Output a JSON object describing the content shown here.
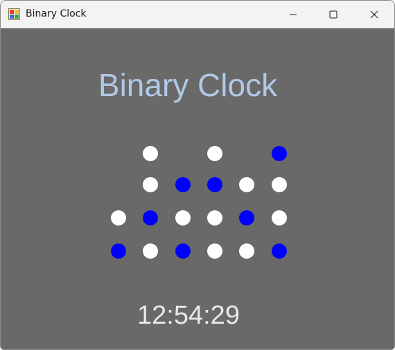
{
  "window": {
    "title": "Binary Clock",
    "controls": [
      "minimize",
      "maximize",
      "close"
    ]
  },
  "app": {
    "heading": "Binary Clock",
    "time": "12:54:29",
    "dot_colors": {
      "on": "#0000ff",
      "off": "#ffffff"
    },
    "columns": [
      {
        "digit": 1,
        "bits": [
          null,
          null,
          0,
          1
        ]
      },
      {
        "digit": 2,
        "bits": [
          0,
          0,
          1,
          0
        ]
      },
      {
        "digit": 5,
        "bits": [
          null,
          1,
          0,
          1
        ]
      },
      {
        "digit": 4,
        "bits": [
          0,
          1,
          0,
          0
        ]
      },
      {
        "digit": 2,
        "bits": [
          null,
          0,
          1,
          0
        ]
      },
      {
        "digit": 9,
        "bits": [
          1,
          0,
          0,
          1
        ]
      }
    ]
  }
}
